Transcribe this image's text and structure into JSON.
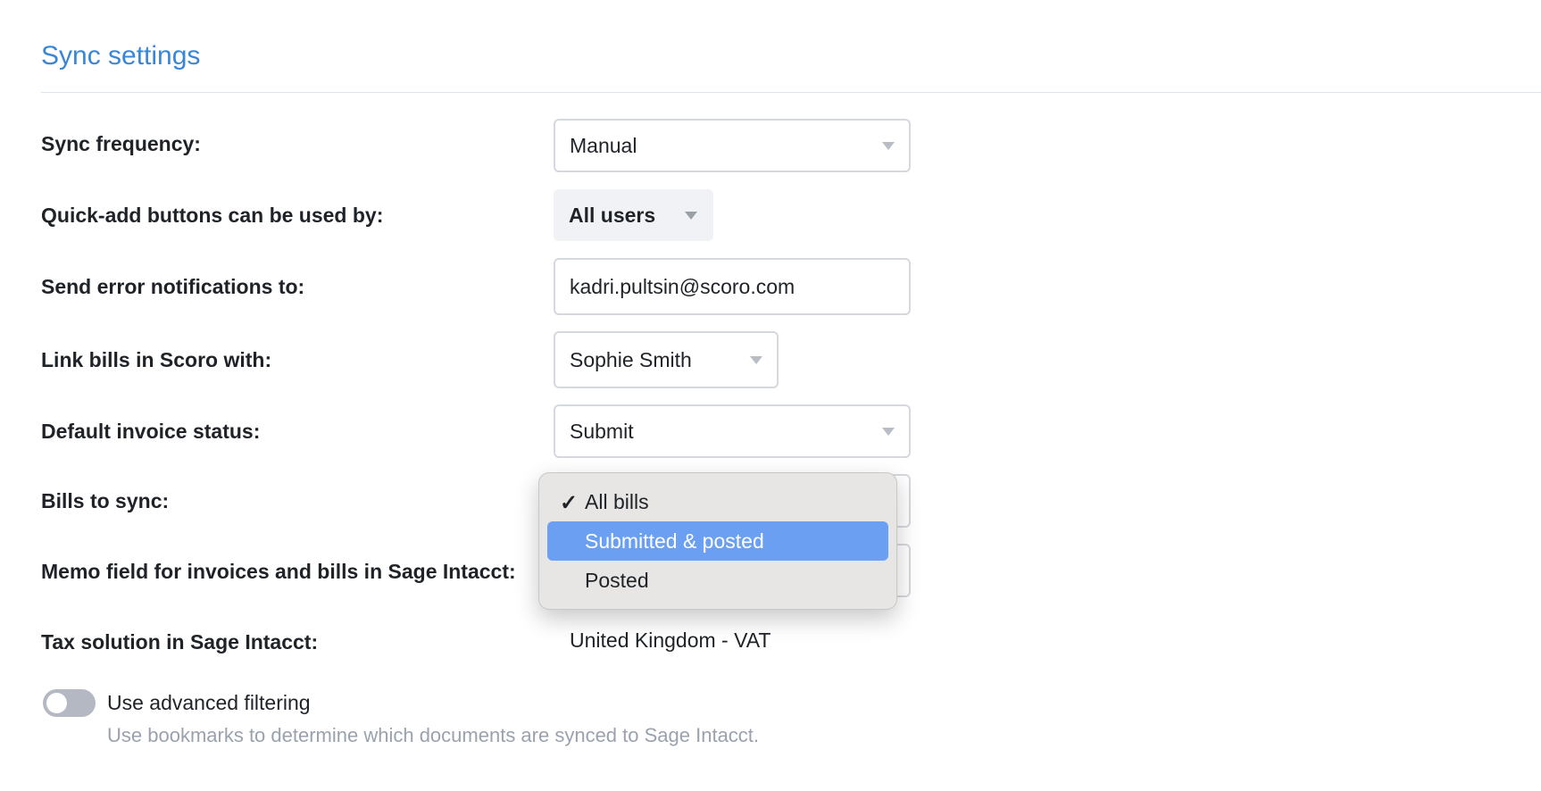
{
  "section": {
    "title": "Sync settings"
  },
  "rows": {
    "sync_frequency": {
      "label": "Sync frequency:",
      "value": "Manual"
    },
    "quick_add": {
      "label": "Quick-add buttons can be used by:",
      "value": "All users"
    },
    "error_notifications": {
      "label": "Send error notifications to:",
      "value": "kadri.pultsin@scoro.com"
    },
    "link_bills": {
      "label": "Link bills in Scoro with:",
      "value": "Sophie Smith"
    },
    "invoice_status": {
      "label": "Default invoice status:",
      "value": "Submit"
    },
    "bills_to_sync": {
      "label": "Bills to sync:"
    },
    "memo_field": {
      "label": "Memo field for invoices and bills in Sage Intacct:"
    },
    "tax_solution": {
      "label": "Tax solution in Sage Intacct:",
      "value": "United Kingdom - VAT"
    }
  },
  "bills_menu": {
    "options": [
      {
        "label": "All bills",
        "checked": true
      },
      {
        "label": "Submitted & posted",
        "highlighted": true
      },
      {
        "label": "Posted"
      }
    ],
    "check_glyph": "✓"
  },
  "advanced_filtering": {
    "label": "Use advanced filtering",
    "description": "Use bookmarks to determine which documents are synced to Sage Intacct.",
    "enabled": false
  },
  "colors": {
    "accent": "#3a86d6",
    "menu_highlight": "#6a9ff2",
    "toggle_off": "#b3b8c2"
  }
}
